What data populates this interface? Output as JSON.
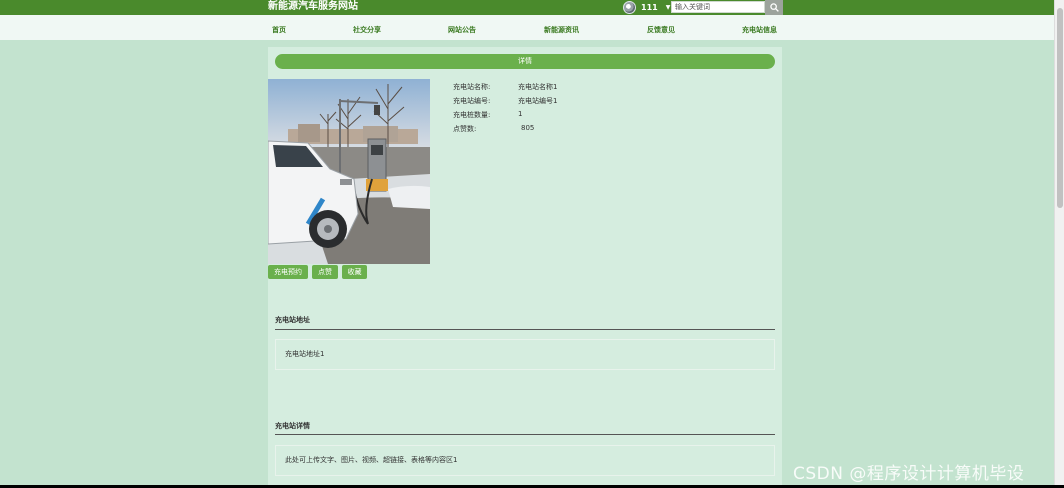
{
  "header": {
    "site_title": "新能源汽车服务网站",
    "username": "111",
    "search_placeholder": "输入关键词"
  },
  "nav": {
    "items": [
      {
        "label": "首页"
      },
      {
        "label": "社交分享"
      },
      {
        "label": "网站公告"
      },
      {
        "label": "新能源资讯"
      },
      {
        "label": "反馈意见"
      },
      {
        "label": "充电站信息"
      }
    ]
  },
  "detail": {
    "section_title": "详情",
    "fields": [
      {
        "label": "充电站名称:",
        "value": "充电站名称1"
      },
      {
        "label": "充电站编号:",
        "value": "充电站编号1"
      },
      {
        "label": "充电桩数量:",
        "value": "1"
      },
      {
        "label": "点赞数:",
        "value": "805"
      }
    ],
    "buttons": {
      "reserve": "充电预约",
      "like": "点赞",
      "favorite": "收藏"
    }
  },
  "address": {
    "title": "充电站地址",
    "content": "充电站地址1"
  },
  "details_section": {
    "title": "充电站详情",
    "content": "此处可上传文字、图片、视频、超链接、表格等内容区1"
  },
  "watermark": "CSDN @程序设计计算机毕设",
  "colors": {
    "header_bg": "#4a8a2c",
    "accent": "#6ab04c",
    "page_bg": "#c3e3cf",
    "panel_bg": "#d5eddf",
    "nav_bg": "#f0f8f4"
  },
  "icons": {
    "search": "search-icon",
    "dropdown": "caret-down-icon"
  }
}
